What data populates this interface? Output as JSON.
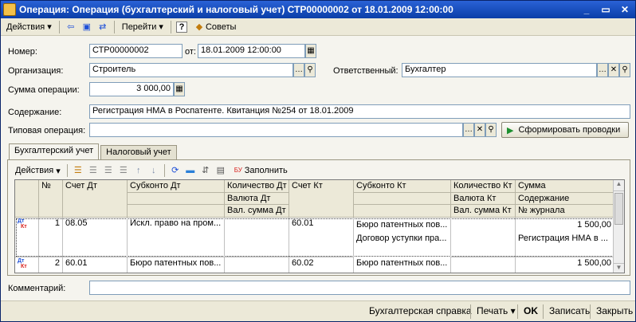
{
  "window": {
    "title": "Операция: Операция (бухгалтерский и налоговый учет) СТР00000002 от 18.01.2009 12:00:00",
    "controls": [
      "_",
      "▭",
      "✕"
    ]
  },
  "toolbar": {
    "actions_label": "Действия",
    "goto_label": "Перейти",
    "help_label": "?",
    "tips_label": "Советы"
  },
  "form": {
    "number_label": "Номер:",
    "number_value": "СТР00000002",
    "date_label": "от:",
    "date_value": "18.01.2009 12:00:00",
    "org_label": "Организация:",
    "org_value": "Строитель",
    "responsible_label": "Ответственный:",
    "responsible_value": "Бухгалтер",
    "amount_label": "Сумма операции:",
    "amount_value": "3 000,00",
    "content_label": "Содержание:",
    "content_value": "Регистрация НМА в Роспатенте. Квитанция №254 от 18.01.2009",
    "template_label": "Типовая операция:",
    "template_value": "",
    "generate_button": "Сформировать проводки",
    "comment_label": "Комментарий:",
    "comment_value": ""
  },
  "tabs": [
    {
      "label": "Бухгалтерский учет",
      "active": true
    },
    {
      "label": "Налоговый учет",
      "active": false
    }
  ],
  "grid_toolbar": {
    "actions_label": "Действия",
    "fill_label": "Заполнить"
  },
  "grid": {
    "headers": {
      "num": "№",
      "debit_account": "Счет Дт",
      "debit_subconto": "Субконто Дт",
      "debit_qty": "Количество Дт",
      "debit_currency": "Валюта Дт",
      "debit_cur_sum": "Вал. сумма Дт",
      "credit_account": "Счет Кт",
      "credit_subconto": "Субконто Кт",
      "credit_qty": "Количество Кт",
      "credit_currency": "Валюта Кт",
      "credit_cur_sum": "Вал. сумма Кт",
      "sum": "Сумма",
      "content": "Содержание",
      "journal": "№ журнала"
    },
    "row_icon_text": {
      "dt": "Дт",
      "kt": "Кт"
    },
    "rows": [
      {
        "num": "1",
        "debit_account": "08.05",
        "debit_subconto": "Искл. право на пром...",
        "credit_account": "60.01",
        "credit_subconto_1": "Бюро патентных пов...",
        "credit_subconto_2": "Договор уступки пра...",
        "sum": "1 500,00",
        "content": "Регистрация НМА в ..."
      },
      {
        "num": "2",
        "debit_account": "60.01",
        "debit_subconto": "Бюро патентных пов...",
        "credit_account": "60.02",
        "credit_subconto_1": "Бюро патентных пов...",
        "sum": "1 500,00"
      }
    ]
  },
  "footer": {
    "report_button": "Бухгалтерская справка",
    "print_button": "Печать",
    "ok_button": "OK",
    "save_button": "Записать",
    "close_button": "Закрыть"
  }
}
